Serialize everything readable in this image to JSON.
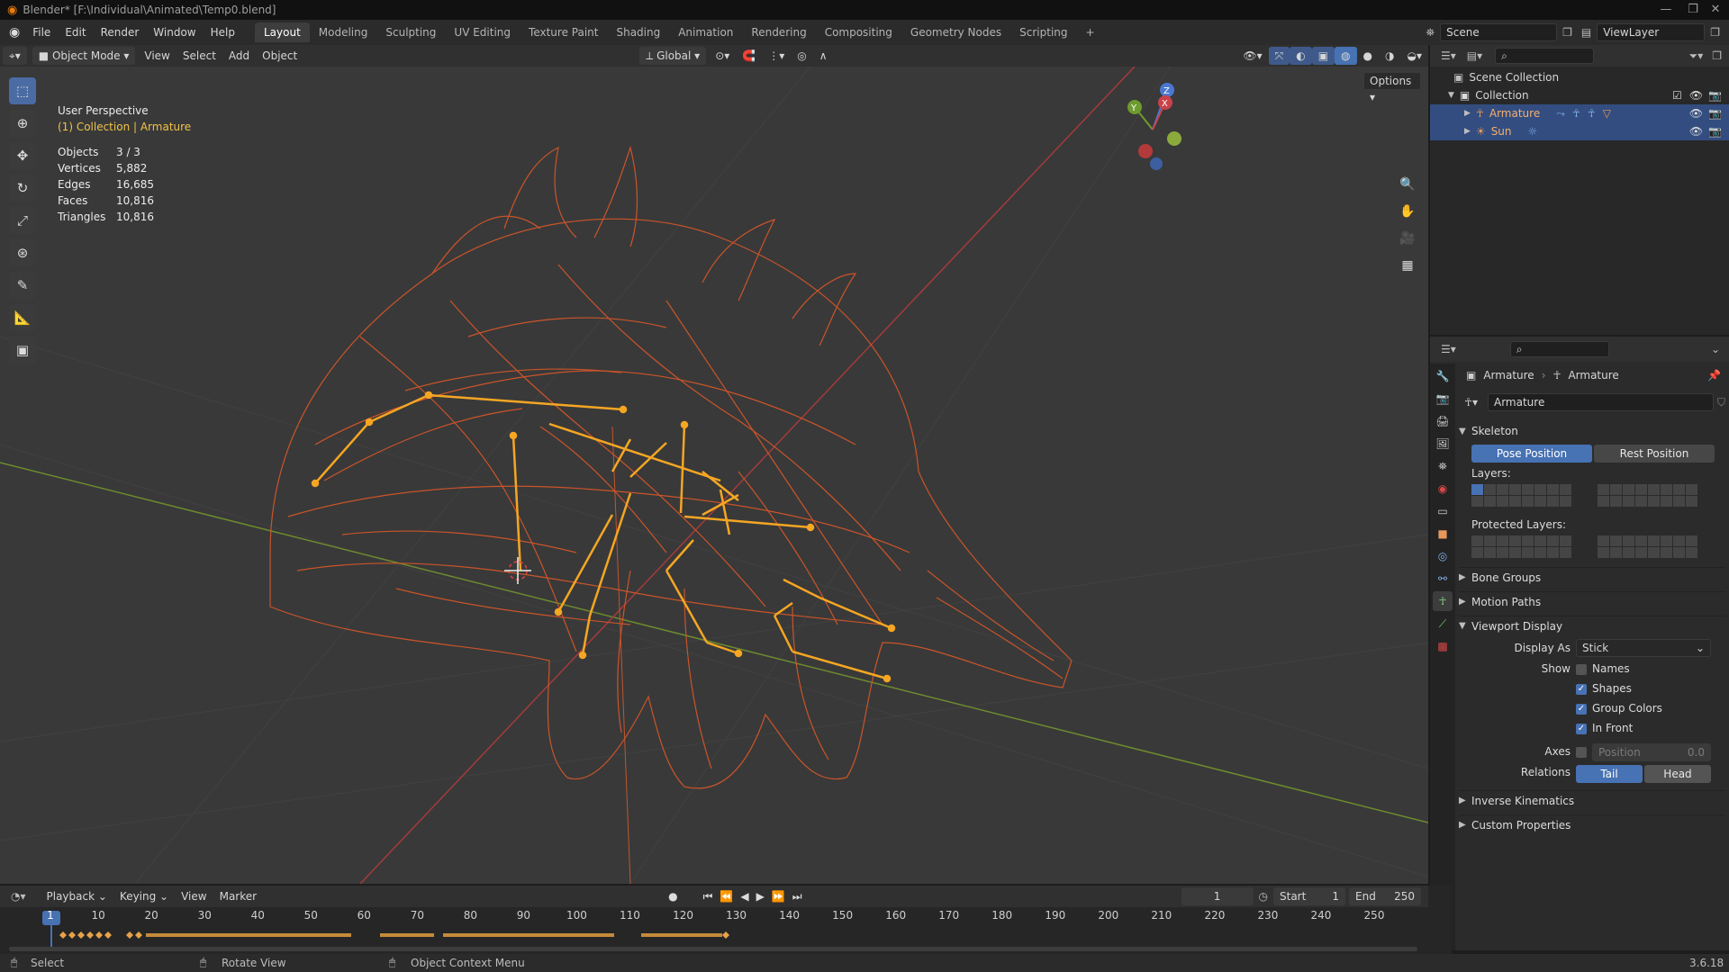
{
  "title": "Blender* [F:\\Individual\\Animated\\Temp0.blend]",
  "menu": [
    "File",
    "Edit",
    "Render",
    "Window",
    "Help"
  ],
  "workspaces": [
    "Layout",
    "Modeling",
    "Sculpting",
    "UV Editing",
    "Texture Paint",
    "Shading",
    "Animation",
    "Rendering",
    "Compositing",
    "Geometry Nodes",
    "Scripting"
  ],
  "active_workspace": "Layout",
  "scene": "Scene",
  "view_layer": "ViewLayer",
  "viewport_header": {
    "mode": "Object Mode",
    "menus": [
      "View",
      "Select",
      "Add",
      "Object"
    ],
    "orientation": "Global",
    "options": "Options"
  },
  "viewport": {
    "view_name": "User Perspective",
    "collection_info": "(1) Collection | Armature",
    "stats": [
      {
        "label": "Objects",
        "value": "3 / 3"
      },
      {
        "label": "Vertices",
        "value": "5,882"
      },
      {
        "label": "Edges",
        "value": "16,685"
      },
      {
        "label": "Faces",
        "value": "10,816"
      },
      {
        "label": "Triangles",
        "value": "10,816"
      }
    ],
    "gizmo_axes": {
      "x": "X",
      "y": "Y",
      "z": "Z"
    },
    "colors": {
      "mesh": "#d2562a",
      "bones": "#f5a623",
      "bg": "#393939",
      "x_axis": "#a33b3b",
      "y_axis": "#6d8b2f"
    }
  },
  "outliner": {
    "rows": [
      {
        "label": "Scene Collection"
      },
      {
        "label": "Collection"
      },
      {
        "label": "Armature"
      },
      {
        "label": "Sun"
      }
    ]
  },
  "properties": {
    "breadcrumb": [
      "Armature",
      "Armature"
    ],
    "datablock": "Armature",
    "skeleton": {
      "title": "Skeleton",
      "pose_position": "Pose Position",
      "rest_position": "Rest Position",
      "layers_label": "Layers:",
      "protected_layers_label": "Protected Layers:"
    },
    "bone_groups": "Bone Groups",
    "motion_paths": "Motion Paths",
    "viewport_display": {
      "title": "Viewport Display",
      "display_as_label": "Display As",
      "display_as": "Stick",
      "show_label": "Show",
      "names": "Names",
      "shapes": "Shapes",
      "group_colors": "Group Colors",
      "in_front": "In Front",
      "axes_label": "Axes",
      "axes_position": "Position",
      "axes_value": "0.0",
      "relations_label": "Relations",
      "tail": "Tail",
      "head": "Head"
    },
    "inverse_kinematics": "Inverse Kinematics",
    "custom_properties": "Custom Properties"
  },
  "timeline": {
    "menus": [
      "Playback",
      "Keying",
      "View",
      "Marker"
    ],
    "current_frame": "1",
    "start_label": "Start",
    "start": "1",
    "end_label": "End",
    "end": "250",
    "ticks": [
      "1",
      "10",
      "20",
      "30",
      "40",
      "50",
      "60",
      "70",
      "80",
      "90",
      "100",
      "110",
      "120",
      "130",
      "140",
      "150",
      "160",
      "170",
      "180",
      "190",
      "200",
      "210",
      "220",
      "230",
      "240",
      "250"
    ]
  },
  "statusbar": {
    "select": "Select",
    "rotate": "Rotate View",
    "context": "Object Context Menu",
    "version": "3.6.18"
  }
}
